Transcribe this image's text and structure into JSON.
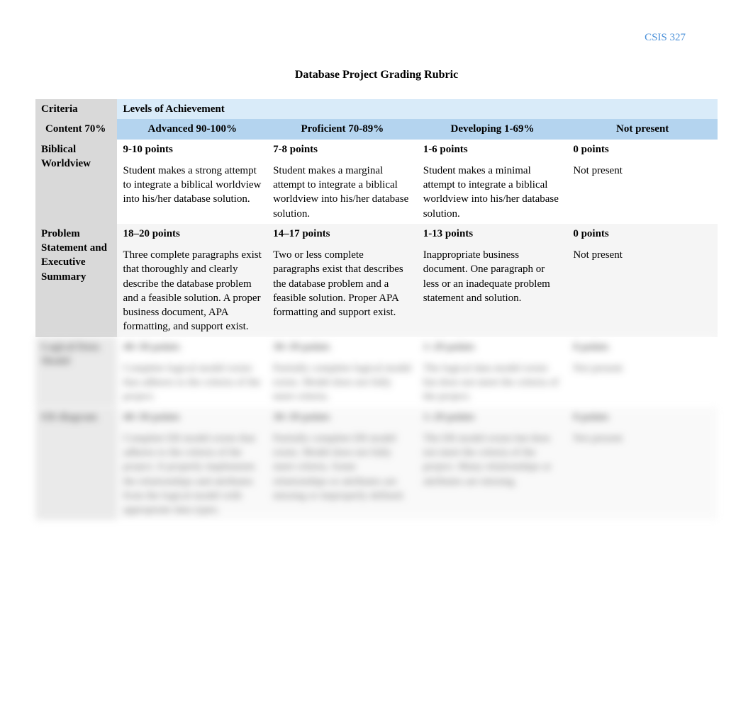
{
  "course_code": "CSIS 327",
  "title": "Database Project Grading Rubric",
  "headers": {
    "criteria": "Criteria",
    "levels": "Levels of Achievement",
    "content_label": "Content 70%",
    "advanced": "Advanced 90-100%",
    "proficient": "Proficient 70-89%",
    "developing": "Developing 1-69%",
    "not_present": "Not present"
  },
  "rows": [
    {
      "criteria": "Biblical Worldview",
      "advanced_pts": "9-10 points",
      "advanced_desc": "Student makes a strong attempt to integrate a biblical worldview into his/her database solution.",
      "proficient_pts": "7-8 points",
      "proficient_desc": "Student makes a marginal attempt to integrate a biblical worldview into his/her database solution.",
      "developing_pts": "1-6 points",
      "developing_desc": "Student makes a minimal attempt to integrate a biblical worldview into his/her database solution.",
      "notpresent_pts": "0 points",
      "notpresent_desc": "Not present"
    },
    {
      "criteria": "Problem Statement and Executive Summary",
      "advanced_pts": "18–20 points",
      "advanced_desc": "Three complete paragraphs exist that thoroughly and clearly describe the database problem and a feasible solution. A proper business document, APA formatting, and support exist.",
      "proficient_pts": "14–17 points",
      "proficient_desc": "Two or less complete paragraphs exist that describes the database problem and a feasible solution. Proper APA formatting and support exist.",
      "developing_pts": "1-13 points",
      "developing_desc": "Inappropriate business document. One paragraph or less or an inadequate problem statement and solution.",
      "notpresent_pts": "0 points",
      "notpresent_desc": "Not present"
    },
    {
      "criteria": "Logical Data Model",
      "advanced_pts": "40–50 points",
      "advanced_desc": "Complete logical model exists that adheres to the criteria of the project.",
      "proficient_pts": "30–39 points",
      "proficient_desc": "Partially complete logical model exists. Model does not fully meet criteria.",
      "developing_pts": "1–29 points",
      "developing_desc": "The logical data model exists but does not meet the criteria of the project.",
      "notpresent_pts": "0 points",
      "notpresent_desc": "Not present"
    },
    {
      "criteria": "ER diagram",
      "advanced_pts": "40–50 points",
      "advanced_desc": "Complete ER model exists that adheres to the criteria of the project. It properly implements the relationships and attributes from the logical model with appropriate data types.",
      "proficient_pts": "30–39 points",
      "proficient_desc": "Partially complete ER model exists. Model does not fully meet criteria. Some relationships or attributes are missing or improperly defined.",
      "developing_pts": "1–29 points",
      "developing_desc": "The ER model exists but does not meet the criteria of the project. Many relationships or attributes are missing.",
      "notpresent_pts": "0 points",
      "notpresent_desc": "Not present"
    }
  ]
}
